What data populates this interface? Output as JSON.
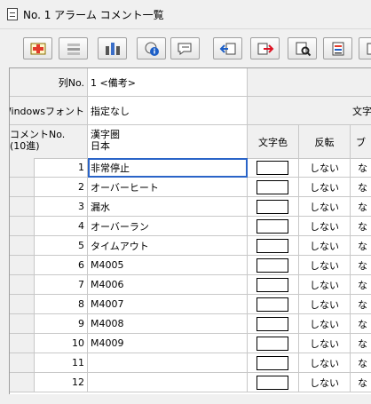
{
  "window": {
    "title": "No. 1 アラーム コメント一覧"
  },
  "toolbar": {
    "buttons": [
      {
        "icon": "add-row-icon"
      },
      {
        "icon": "delete-row-icon"
      },
      {
        "icon": "column-settings-icon"
      },
      {
        "icon": "info-icon"
      },
      {
        "icon": "comment-edit-icon"
      },
      {
        "icon": "import-icon"
      },
      {
        "icon": "export-excel-icon"
      },
      {
        "icon": "find-icon"
      },
      {
        "icon": "print-icon"
      },
      {
        "icon": "more-icon"
      }
    ]
  },
  "grid": {
    "col_no_label": "列No.",
    "col_no_value": "1 <備考>",
    "windows_font_label": "Windowsフォント",
    "windows_font_value": "指定なし",
    "partial_header_right": "文字",
    "comment_no_label": "コメントNo.\n(10進)",
    "kanji_label": "漢字圏\n日本",
    "text_color_label": "文字色",
    "invert_label": "反転",
    "blink_label_partial": "ブ",
    "rows": [
      {
        "no": "1",
        "comment": "非常停止",
        "invert": "しない",
        "extra": "な"
      },
      {
        "no": "2",
        "comment": "オーバーヒート",
        "invert": "しない",
        "extra": "な"
      },
      {
        "no": "3",
        "comment": "漏水",
        "invert": "しない",
        "extra": "な"
      },
      {
        "no": "4",
        "comment": "オーバーラン",
        "invert": "しない",
        "extra": "な"
      },
      {
        "no": "5",
        "comment": "タイムアウト",
        "invert": "しない",
        "extra": "な"
      },
      {
        "no": "6",
        "comment": "M4005",
        "invert": "しない",
        "extra": "な"
      },
      {
        "no": "7",
        "comment": "M4006",
        "invert": "しない",
        "extra": "な"
      },
      {
        "no": "8",
        "comment": "M4007",
        "invert": "しない",
        "extra": "な"
      },
      {
        "no": "9",
        "comment": "M4008",
        "invert": "しない",
        "extra": "な"
      },
      {
        "no": "10",
        "comment": "M4009",
        "invert": "しない",
        "extra": "な"
      },
      {
        "no": "11",
        "comment": "",
        "invert": "しない",
        "extra": "な"
      },
      {
        "no": "12",
        "comment": "",
        "invert": "しない",
        "extra": "な"
      }
    ]
  },
  "colors": {
    "selection": "#2a64c8",
    "header_bg": "#f0f0f0",
    "grid_line": "#c8c8c8"
  }
}
